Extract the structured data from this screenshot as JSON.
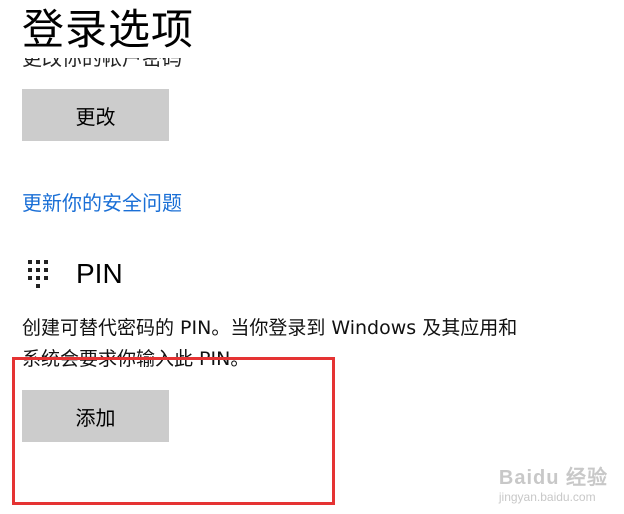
{
  "header": {
    "title": "登录选项"
  },
  "password_section": {
    "partial_text": "更改你的帐户密码",
    "change_button": "更改",
    "security_link": "更新你的安全问题"
  },
  "pin_section": {
    "icon": "keypad-icon",
    "title": "PIN",
    "description_line1": "创建可替代密码的 PIN。当你登录到 Windows 及其应用和",
    "description_line2": "系统会要求你输入此 PIN。",
    "add_button": "添加"
  },
  "annotation": {
    "highlight_color": "#e53333"
  },
  "watermark": {
    "logo": "Baidu 经验",
    "url": "jingyan.baidu.com"
  }
}
